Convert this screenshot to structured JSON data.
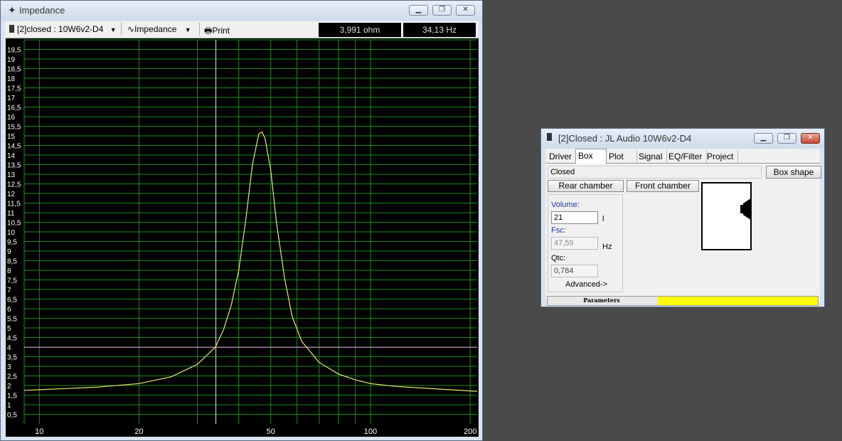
{
  "impedance_window": {
    "title": "Impedance",
    "driver_select": "[2]closed : 10W6v2-D4",
    "mode_select": "Impedance",
    "print_label": "Print",
    "readout_ohm": "3,991 ohm",
    "readout_hz": "34,13 Hz"
  },
  "chart_data": {
    "type": "line",
    "xscale": "log",
    "xlim": [
      9,
      210
    ],
    "ylim": [
      0,
      20
    ],
    "x_tick_labels": [
      "10",
      "20",
      "50",
      "100",
      "200"
    ],
    "y_tick_labels": [
      "0,5",
      "1",
      "1,5",
      "2",
      "2,5",
      "3",
      "3,5",
      "4",
      "4,5",
      "5",
      "5,5",
      "6",
      "6,5",
      "7",
      "7,5",
      "8",
      "8,5",
      "9",
      "9,5",
      "10",
      "10,5",
      "11",
      "11,5",
      "12",
      "12,5",
      "13",
      "13,5",
      "14",
      "14,5",
      "15",
      "15,5",
      "16",
      "16,5",
      "17",
      "17,5",
      "18",
      "18,5",
      "19",
      "19,5"
    ],
    "grid": true,
    "cursor": {
      "x": 34.13,
      "y": 3.991
    },
    "series": [
      {
        "color": "#e8e870",
        "x": [
          9,
          10,
          12,
          15,
          20,
          25,
          30,
          34,
          36,
          38,
          40,
          42,
          44,
          46,
          47,
          48,
          50,
          52,
          55,
          58,
          62,
          70,
          80,
          90,
          100,
          120,
          150,
          200,
          210
        ],
        "y": [
          1.75,
          1.78,
          1.84,
          1.92,
          2.1,
          2.45,
          3.1,
          4.0,
          4.9,
          6.2,
          8.0,
          10.6,
          13.5,
          15.1,
          15.2,
          14.9,
          13.2,
          10.5,
          7.6,
          5.6,
          4.3,
          3.2,
          2.6,
          2.3,
          2.1,
          1.95,
          1.85,
          1.72,
          1.7
        ]
      }
    ]
  },
  "closed_window": {
    "title": "[2]Closed : JL Audio 10W6v2-D4",
    "tabs": [
      "Driver",
      "Box",
      "Plot",
      "Signal",
      "EQ/Filter",
      "Project"
    ],
    "active_tab": "Box",
    "box_type": "Closed",
    "box_shape_button": "Box shape",
    "rear_chamber_button": "Rear chamber",
    "front_chamber_button": "Front chamber",
    "volume_label": "Volume:",
    "volume_value": "21",
    "volume_unit": "l",
    "fsc_label": "Fsc:",
    "fsc_value": "47,59",
    "fsc_unit": "Hz",
    "qtc_label": "Qtc:",
    "qtc_value": "0,784",
    "advanced_button": "Advanced->",
    "parameters_label": "Parameters",
    "status_color": "#ffff00"
  }
}
